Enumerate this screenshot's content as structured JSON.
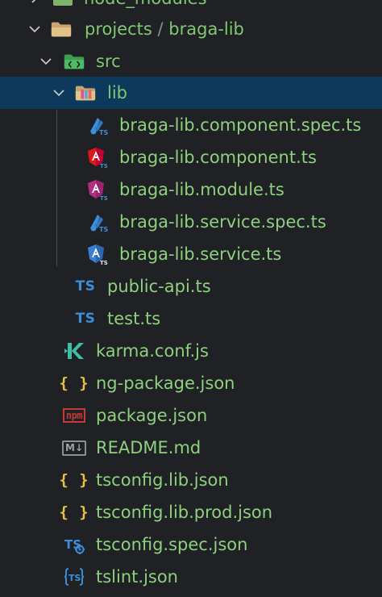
{
  "tree": {
    "top_cutoff": {
      "label": "node_modules"
    },
    "projects_folder": {
      "label_a": "projects",
      "separator": "/",
      "label_b": "braga-lib"
    },
    "src_folder": {
      "label": "src"
    },
    "lib_folder": {
      "label": "lib",
      "selected": true
    },
    "files": {
      "component_spec": "braga-lib.component.spec.ts",
      "component": "braga-lib.component.ts",
      "module": "braga-lib.module.ts",
      "service_spec": "braga-lib.service.spec.ts",
      "service": "braga-lib.service.ts",
      "public_api": "public-api.ts",
      "test": "test.ts",
      "karma": "karma.conf.js",
      "ng_package": "ng-package.json",
      "package": "package.json",
      "readme": "README.md",
      "tsconfig_lib": "tsconfig.lib.json",
      "tsconfig_lib_prod": "tsconfig.lib.prod.json",
      "tsconfig_spec": "tsconfig.spec.json",
      "tslint": "tslint.json"
    },
    "icon_text": {
      "ts": "TS",
      "braces": "{ }",
      "npm": "npm",
      "md": "M↓"
    }
  },
  "colors": {
    "background": "#1f2125",
    "selected_row": "#0d3a5c",
    "label_green": "#8ed07e",
    "ts_blue": "#3b8fd8",
    "json_yellow": "#e5c146",
    "angular_red": "#dd1b16",
    "npm_red": "#c23b38"
  },
  "icons": {
    "folder": "folder-icon",
    "src": "src-folder-icon",
    "lib": "lib-folder-icon",
    "angular_spec": "angular-spec-icon",
    "angular_component": "angular-component-icon",
    "angular_module": "angular-module-icon",
    "angular_service": "angular-service-icon",
    "typescript": "typescript-icon",
    "karma": "karma-icon",
    "json": "json-icon",
    "npm": "npm-icon",
    "markdown": "markdown-icon",
    "tsconfig": "tsconfig-icon",
    "tslint": "tslint-icon"
  }
}
